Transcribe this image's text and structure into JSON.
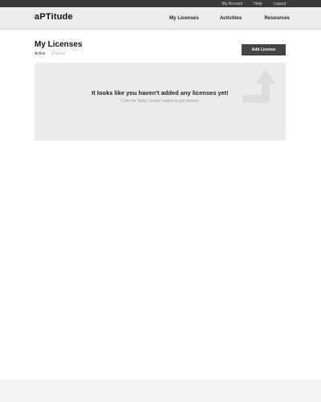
{
  "topbar": {
    "links": [
      "My Account",
      "Help",
      "Logout"
    ]
  },
  "navbar": {
    "logo": "aPTitude",
    "items": [
      "My Licenses",
      "Activities",
      "Resources"
    ]
  },
  "page": {
    "title": "My Licenses",
    "tabs": [
      "Active",
      "Expired"
    ],
    "add_button": "Add License"
  },
  "empty_state": {
    "heading": "It looks like you haven't added any licenses yet!",
    "subtext": "Click the 'Add License' button to get started.",
    "icon": "up-arrow-icon"
  }
}
